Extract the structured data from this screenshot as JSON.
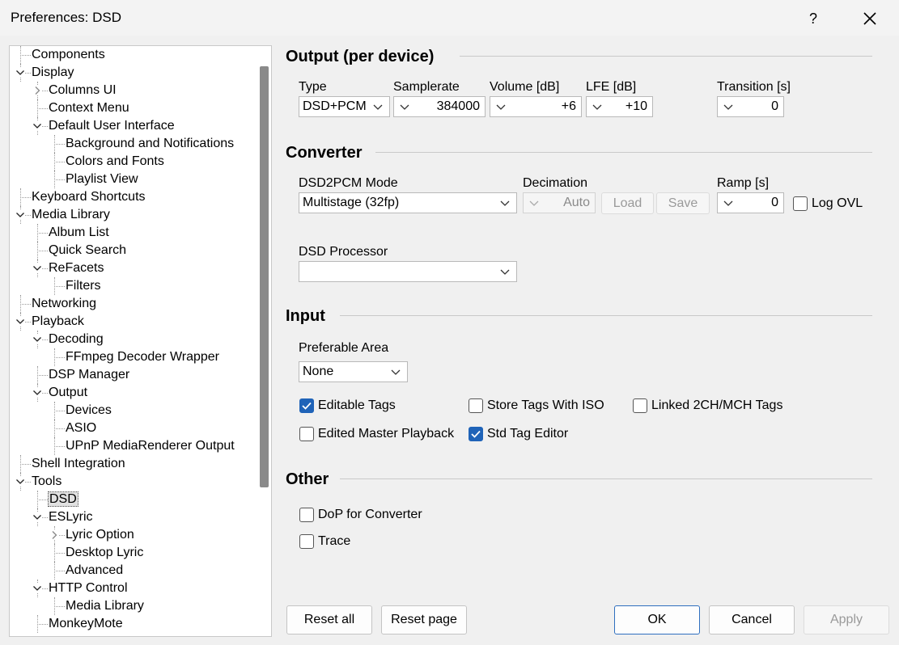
{
  "window": {
    "title": "Preferences: DSD",
    "help_label": "?"
  },
  "tree": {
    "items": [
      {
        "label": "Components"
      },
      {
        "label": "Display"
      },
      {
        "label": "Columns UI"
      },
      {
        "label": "Context Menu"
      },
      {
        "label": "Default User Interface"
      },
      {
        "label": "Background and Notifications"
      },
      {
        "label": "Colors and Fonts"
      },
      {
        "label": "Playlist View"
      },
      {
        "label": "Keyboard Shortcuts"
      },
      {
        "label": "Media Library"
      },
      {
        "label": "Album List"
      },
      {
        "label": "Quick Search"
      },
      {
        "label": "ReFacets"
      },
      {
        "label": "Filters"
      },
      {
        "label": "Networking"
      },
      {
        "label": "Playback"
      },
      {
        "label": "Decoding"
      },
      {
        "label": "FFmpeg Decoder Wrapper"
      },
      {
        "label": "DSP Manager"
      },
      {
        "label": "Output"
      },
      {
        "label": "Devices"
      },
      {
        "label": "ASIO"
      },
      {
        "label": "UPnP MediaRenderer Output"
      },
      {
        "label": "Shell Integration"
      },
      {
        "label": "Tools"
      },
      {
        "label": "DSD"
      },
      {
        "label": "ESLyric"
      },
      {
        "label": "Lyric Option"
      },
      {
        "label": "Desktop Lyric"
      },
      {
        "label": "Advanced"
      },
      {
        "label": "HTTP Control"
      },
      {
        "label": "Media Library"
      },
      {
        "label": "MonkeyMote"
      }
    ]
  },
  "output": {
    "title": "Output (per device)",
    "type_label": "Type",
    "type_value": "DSD+PCM",
    "samplerate_label": "Samplerate",
    "samplerate_value": "384000",
    "volume_label": "Volume [dB]",
    "volume_value": "+6",
    "lfe_label": "LFE [dB]",
    "lfe_value": "+10",
    "transition_label": "Transition [s]",
    "transition_value": "0"
  },
  "converter": {
    "title": "Converter",
    "mode_label": "DSD2PCM Mode",
    "mode_value": "Multistage (32fp)",
    "decimation_label": "Decimation",
    "decimation_value": "Auto",
    "load_label": "Load",
    "save_label": "Save",
    "ramp_label": "Ramp [s]",
    "ramp_value": "0",
    "log_ovl_label": "Log OVL",
    "processor_label": "DSD Processor",
    "processor_value": ""
  },
  "input": {
    "title": "Input",
    "area_label": "Preferable Area",
    "area_value": "None",
    "editable_tags": "Editable Tags",
    "store_tags": "Store Tags With ISO",
    "linked_tags": "Linked 2CH/MCH Tags",
    "edited_master": "Edited Master Playback",
    "std_tag_editor": "Std Tag Editor"
  },
  "other": {
    "title": "Other",
    "dop": "DoP for Converter",
    "trace": "Trace"
  },
  "buttons": {
    "reset_all": "Reset all",
    "reset_page": "Reset page",
    "ok": "OK",
    "cancel": "Cancel",
    "apply": "Apply"
  },
  "colors": {
    "accent": "#1f63b8",
    "background": "#f0f0f0"
  }
}
